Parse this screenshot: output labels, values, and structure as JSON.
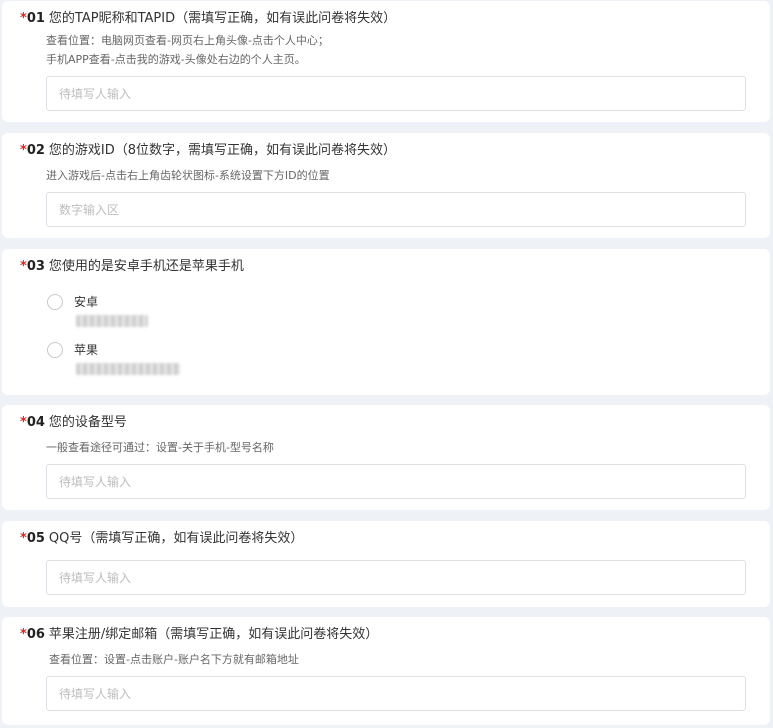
{
  "questions": [
    {
      "required_mark": "*",
      "number": "01",
      "title": "您的TAP昵称和TAPID（需填写正确，如有误此问卷将失效）",
      "desc_lines": [
        "查看位置：电脑网页查看-网页右上角头像-点击个人中心；",
        "手机APP查看-点击我的游戏-头像处右边的个人主页。"
      ],
      "placeholder": "待填写人输入"
    },
    {
      "required_mark": "*",
      "number": "02",
      "title": "您的游戏ID（8位数字，需填写正确，如有误此问卷将失效）",
      "desc_lines": [
        "进入游戏后-点击右上角齿轮状图标-系统设置下方ID的位置"
      ],
      "placeholder": "数字输入区"
    },
    {
      "required_mark": "*",
      "number": "03",
      "title": "您使用的是安卓手机还是苹果手机",
      "options": [
        {
          "label": "安卓"
        },
        {
          "label": "苹果"
        }
      ]
    },
    {
      "required_mark": "*",
      "number": "04",
      "title": "您的设备型号",
      "desc_lines": [
        "一般查看途径可通过：设置-关于手机-型号名称"
      ],
      "placeholder": "待填写人输入"
    },
    {
      "required_mark": "*",
      "number": "05",
      "title": "QQ号（需填写正确，如有误此问卷将失效）",
      "placeholder": "待填写人输入"
    },
    {
      "required_mark": "*",
      "number": "06",
      "title": "苹果注册/绑定邮箱（需填写正确，如有误此问卷将失效）",
      "desc_lines": [
        "查看位置：设置-点击账户-账户名下方就有邮箱地址"
      ],
      "placeholder": "待填写人输入"
    }
  ],
  "colors": {
    "required": "#e02424",
    "page_background": "#eef1f5",
    "card_background": "#ffffff",
    "input_border": "#dcdfe6",
    "placeholder": "#bdbdbd"
  },
  "icons": {
    "radio": "radio-unchecked-icon"
  }
}
